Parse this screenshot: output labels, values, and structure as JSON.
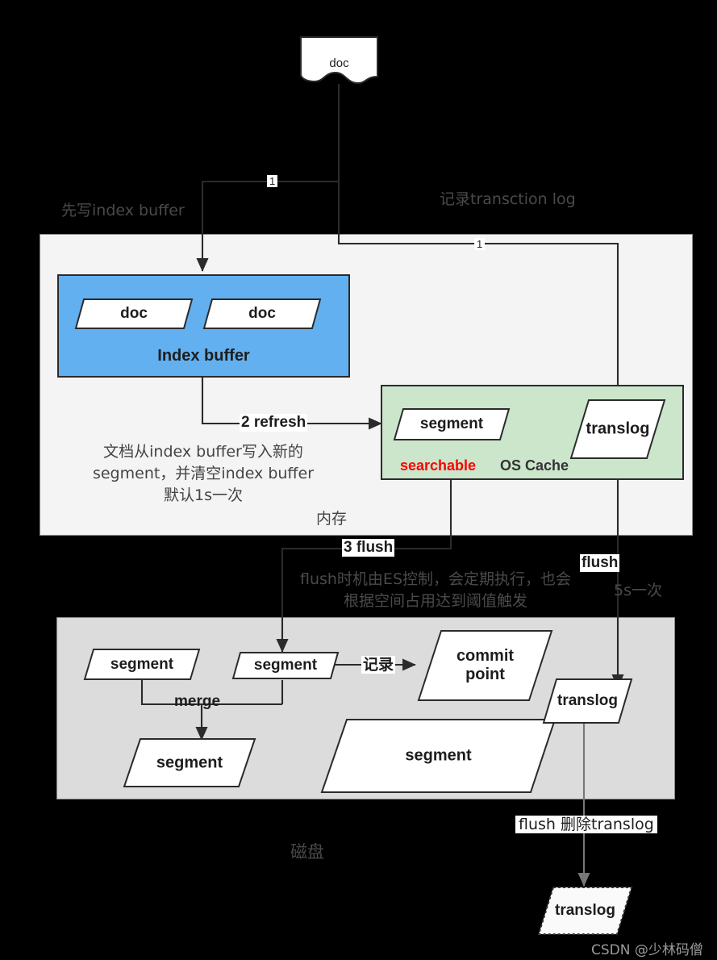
{
  "diagram": {
    "title_watermark": "CSDN @少林码僧",
    "regions": {
      "memory_label": "内存",
      "disk_label": "磁盘",
      "os_cache_label": "OS Cache",
      "searchable_label": "searchable",
      "index_buffer_label": "Index buffer"
    },
    "annotations": {
      "write_index_buffer": "先写index buffer",
      "record_translog": "记录transction log",
      "refresh_desc_line1": "文档从index buffer写入新的",
      "refresh_desc_line2": "segment，并清空index buffer",
      "refresh_desc_line3": "默认1s一次",
      "flush_desc_line1": "flush时机由ES控制，会定期执行，也会",
      "flush_desc_line2": "根据空间占用达到阈值触发",
      "translog_interval": "5s一次"
    },
    "edge_labels": {
      "step1_left": "1",
      "step1_right": "1",
      "step2_refresh": "2 refresh",
      "step3_flush": "3 flush",
      "flush": "flush",
      "record": "记录",
      "merge": "merge",
      "flush_delete_translog": "flush 删除translog"
    },
    "nodes": {
      "doc_top": "doc",
      "doc_buf_1": "doc",
      "doc_buf_2": "doc",
      "segment_cache": "segment",
      "translog_cache": "translog",
      "segment_disk_left": "segment",
      "segment_disk_mid": "segment",
      "segment_merged": "segment",
      "segment_big": "segment",
      "commit_point_line1": "commit",
      "commit_point_line2": "point",
      "translog_disk": "translog",
      "translog_deleted": "translog"
    },
    "colors": {
      "index_buffer_fill": "#62B0F0",
      "os_cache_fill": "#CBE6CB",
      "memory_fill": "#F4F4F4",
      "disk_fill": "#DCDCDC",
      "searchable": "#FF0000",
      "background": "#000000",
      "stroke": "#2B2B2B"
    }
  }
}
